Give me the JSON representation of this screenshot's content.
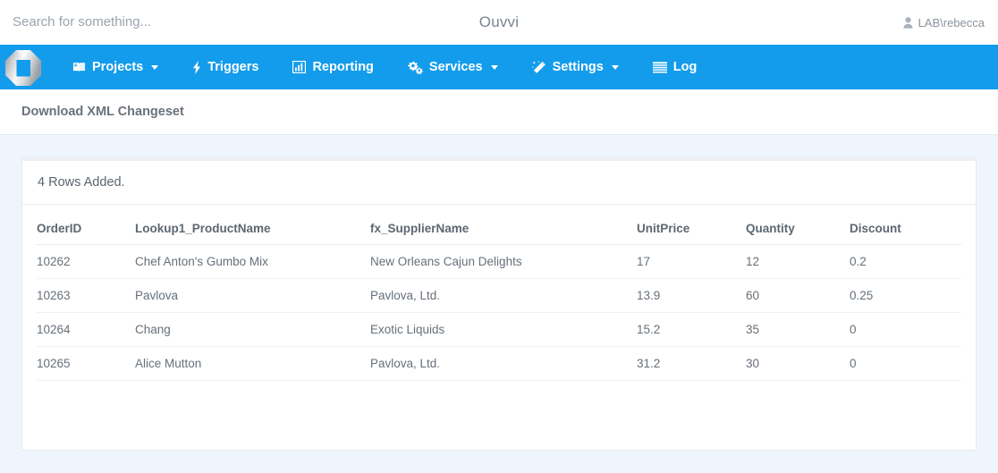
{
  "topbar": {
    "search_placeholder": "Search for something...",
    "search_value": "",
    "app_title": "Ouvvi",
    "user_name": "LAB\\rebecca",
    "user_icon": "user-icon"
  },
  "navbar": {
    "brand_icon": "ouvvi-logo-icon",
    "accent_color": "#139ceb",
    "items": [
      {
        "label": "Projects",
        "icon": "book-icon",
        "has_caret": true
      },
      {
        "label": "Triggers",
        "icon": "bolt-icon",
        "has_caret": false
      },
      {
        "label": "Reporting",
        "icon": "bar-chart-icon",
        "has_caret": false
      },
      {
        "label": "Services",
        "icon": "gears-icon",
        "has_caret": true
      },
      {
        "label": "Settings",
        "icon": "magic-wand-icon",
        "has_caret": true
      },
      {
        "label": "Log",
        "icon": "list-icon",
        "has_caret": false
      }
    ]
  },
  "page": {
    "title": "Download XML Changeset"
  },
  "card": {
    "header": "4 Rows Added.",
    "table": {
      "columns": [
        "OrderID",
        "Lookup1_ProductName",
        "fx_SupplierName",
        "UnitPrice",
        "Quantity",
        "Discount"
      ],
      "rows": [
        [
          "10262",
          "Chef Anton's Gumbo Mix",
          "New Orleans Cajun Delights",
          "17",
          "12",
          "0.2"
        ],
        [
          "10263",
          "Pavlova",
          "Pavlova, Ltd.",
          "13.9",
          "60",
          "0.25"
        ],
        [
          "10264",
          "Chang",
          "Exotic Liquids",
          "15.2",
          "35",
          "0"
        ],
        [
          "10265",
          "Alice Mutton",
          "Pavlova, Ltd.",
          "31.2",
          "30",
          "0"
        ]
      ]
    }
  }
}
